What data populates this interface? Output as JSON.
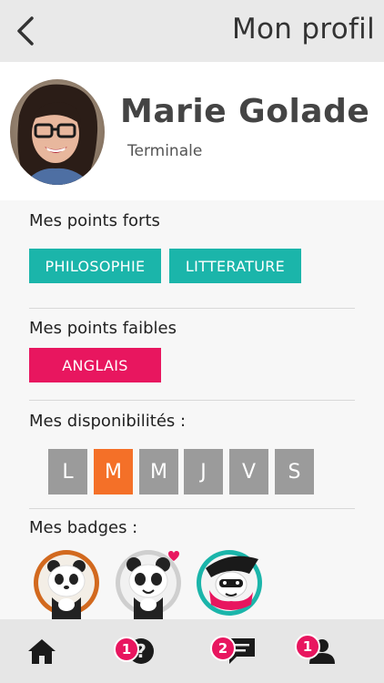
{
  "header": {
    "title": "Mon profil",
    "back_icon": "chevron-left-icon"
  },
  "profile": {
    "name": "Marie Golade",
    "grade": "Terminale"
  },
  "strengths": {
    "title": "Mes points forts",
    "tags": [
      "PHILOSOPHIE",
      "LITTERATURE"
    ],
    "color": "#1bb5aa"
  },
  "weaknesses": {
    "title": "Mes points faibles",
    "tags": [
      "ANGLAIS"
    ],
    "color": "#e8165f"
  },
  "availability": {
    "title": "Mes disponibilités :",
    "days": [
      "L",
      "M",
      "M",
      "J",
      "V",
      "S"
    ],
    "selected_index": 1,
    "active_color": "#f47028",
    "inactive_color": "#9b9b9b"
  },
  "badges": {
    "title": "Mes badges :",
    "items": [
      "panda-orange-badge",
      "panda-love-badge",
      "panda-hero-badge"
    ]
  },
  "nav": {
    "items": [
      {
        "icon": "home-icon",
        "count": null
      },
      {
        "icon": "question-icon",
        "count": "1"
      },
      {
        "icon": "chat-icon",
        "count": "2"
      },
      {
        "icon": "user-icon",
        "count": "1"
      }
    ]
  }
}
